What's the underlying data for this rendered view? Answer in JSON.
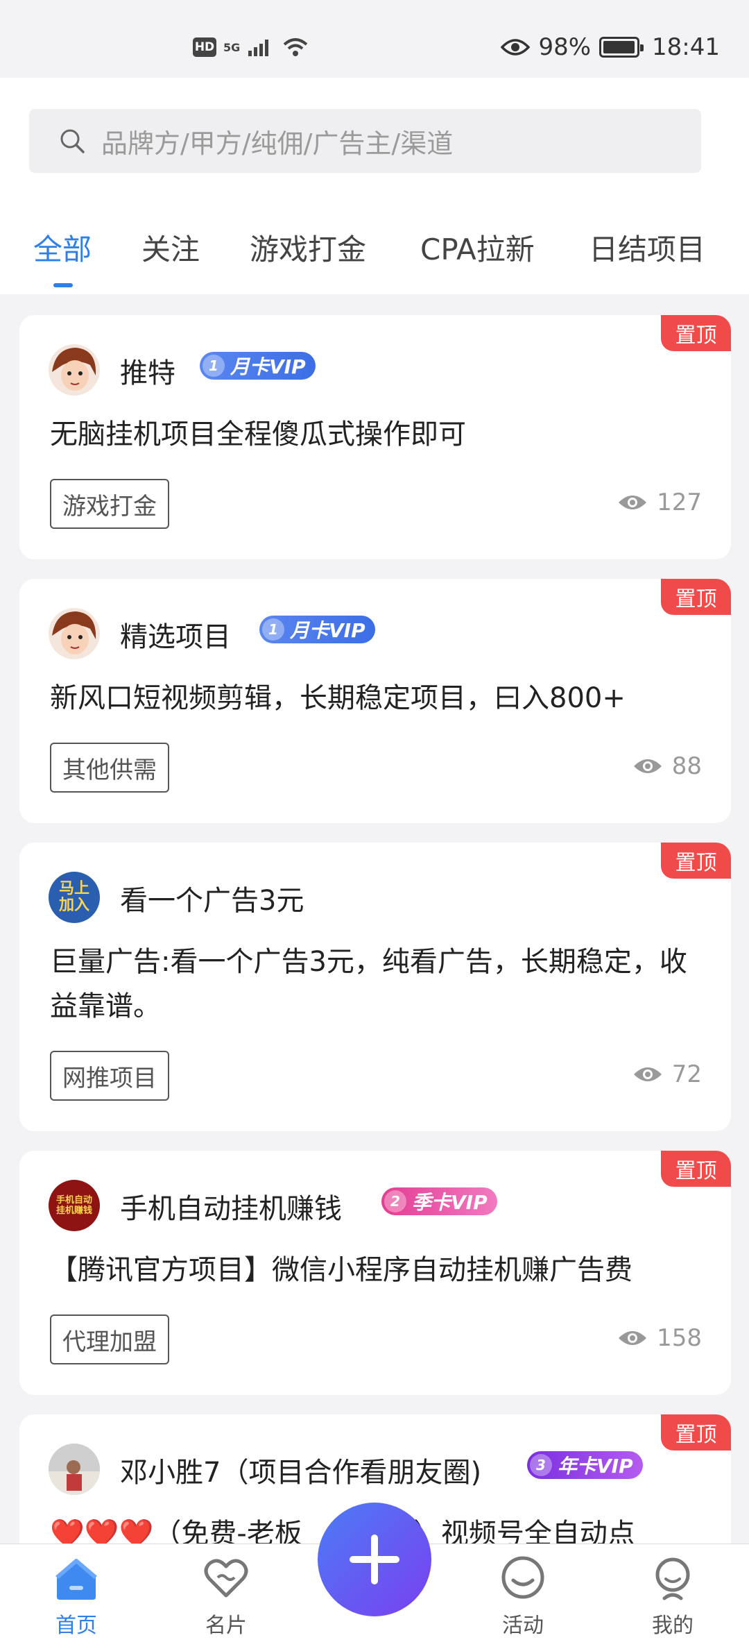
{
  "status_bar": {
    "hd": "HD",
    "network": "5G",
    "battery_percent": "98%",
    "battery_level": 0.98,
    "time": "18:41"
  },
  "search": {
    "placeholder": "品牌方/甲方/纯佣/广告主/渠道"
  },
  "tabs": [
    {
      "label": "全部",
      "active": true
    },
    {
      "label": "关注",
      "active": false
    },
    {
      "label": "游戏打金",
      "active": false
    },
    {
      "label": "CPA拉新",
      "active": false
    },
    {
      "label": "日结项目",
      "active": false
    }
  ],
  "posts": [
    {
      "pin": "置顶",
      "name": "推特",
      "vip": "月卡VIP",
      "vip_level": "1",
      "title": "无脑挂机项目全程傻瓜式操作即可",
      "tag": "游戏打金",
      "views": "127"
    },
    {
      "pin": "置顶",
      "name": "精选项目",
      "vip": "月卡VIP",
      "vip_level": "1",
      "title": "新风口短视频剪辑，长期稳定项目，曰入800+",
      "tag": "其他供需",
      "views": "88"
    },
    {
      "pin": "置顶",
      "name": "看一个广告3元",
      "avatar_text": "马上加入",
      "title": "巨量广告:看一个广告3元，纯看广告，长期稳定，收益靠谱。",
      "tag": "网推项目",
      "views": "72"
    },
    {
      "pin": "置顶",
      "name": "手机自动挂机赚钱",
      "avatar_text": "手机自动挂机赚钱",
      "vip": "季卡VIP",
      "vip_level": "2",
      "title": "【腾讯官方项目】微信小程序自动挂机赚广告费",
      "tag": "代理加盟",
      "views": "158"
    },
    {
      "pin": "置顶",
      "name": "邓小胜7（项目合作看朋友圈)",
      "vip": "年卡VIP",
      "vip_level": "3",
      "title": "❤️❤️❤️（免费-老板",
      "title_tail": "招）视频号全自动点"
    }
  ],
  "bottom_nav": [
    {
      "label": "首页",
      "icon": "home-icon",
      "active": true
    },
    {
      "label": "名片",
      "icon": "card-heart-icon",
      "active": false
    },
    {
      "label": "活动",
      "icon": "activity-chat-icon",
      "active": false
    },
    {
      "label": "我的",
      "icon": "profile-icon",
      "active": false
    }
  ],
  "colors": {
    "accent": "#2f7fe8",
    "pin_red": "#f04a4a",
    "fab_start": "#4b7cf5",
    "fab_end": "#7b3ff0"
  }
}
